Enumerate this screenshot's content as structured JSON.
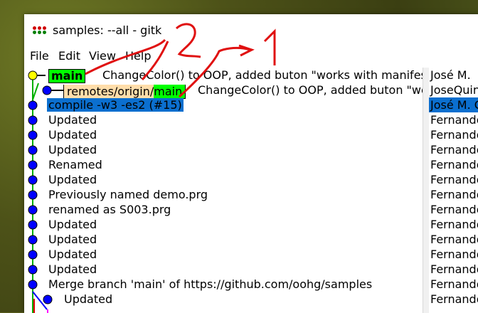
{
  "window": {
    "title": "samples: --all - gitk"
  },
  "menu": [
    "File",
    "Edit",
    "View",
    "Help"
  ],
  "refs": {
    "head": "main",
    "remote_prefix": "remotes/origin/",
    "remote_branch": "main"
  },
  "commits": [
    {
      "message": "ChangeColor() to OOP, added buton \"works with manifest\"",
      "author": "José M."
    },
    {
      "message": "ChangeColor() to OOP, added buton \"works with manifest\"",
      "author": "JoseQuintas"
    },
    {
      "message": "compile -w3 -es2 (#15)",
      "author": "José M. C",
      "selected": true
    },
    {
      "message": "Updated",
      "author": "Fernando"
    },
    {
      "message": "Updated",
      "author": "Fernando"
    },
    {
      "message": "Updated",
      "author": "Fernando"
    },
    {
      "message": "Renamed",
      "author": "Fernando"
    },
    {
      "message": "Updated",
      "author": "Fernando"
    },
    {
      "message": "Previously named demo.prg",
      "author": "Fernando"
    },
    {
      "message": "renamed as S003.prg",
      "author": "Fernando"
    },
    {
      "message": "Updated",
      "author": "Fernando"
    },
    {
      "message": "Updated",
      "author": "Fernando"
    },
    {
      "message": "Updated",
      "author": "Fernando"
    },
    {
      "message": "Updated",
      "author": "Fernando"
    },
    {
      "message": "Merge branch 'main' of https://github.com/oohg/samples",
      "author": "Fernando"
    },
    {
      "message": "Updated",
      "author": "Fernando"
    }
  ],
  "annotations": [
    "2",
    "1"
  ],
  "colors": {
    "graph_line": "#00b000",
    "node": "#0000ff",
    "head_node": "#ffff00",
    "annotation": "#e01010",
    "selection": "#0b6fcf"
  }
}
